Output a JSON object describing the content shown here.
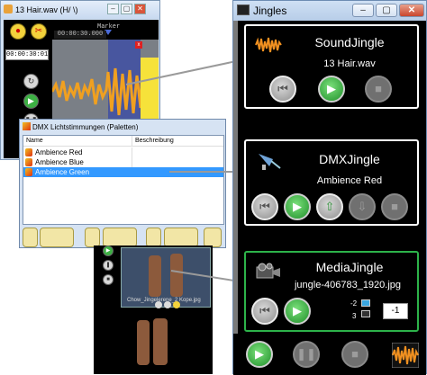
{
  "audio_window": {
    "title": "13 Hair.wav (H/ \\)",
    "marker_label": "Marker",
    "time_top": "00:00:30.000",
    "time_current": "00:00:30:017",
    "colors": {
      "wave": "#f0a020",
      "selection": "#3f4fa3"
    }
  },
  "dmx_window": {
    "title": "DMX Lichtstimmungen (Paletten)",
    "columns": [
      "Name",
      "Beschreibung"
    ],
    "rows": [
      {
        "name": "Ambience Red",
        "selected": false
      },
      {
        "name": "Ambience Blue",
        "selected": false
      },
      {
        "name": "Ambience Green",
        "selected": true
      }
    ],
    "colors": {
      "selection": "#3399ff"
    }
  },
  "media_window": {
    "thumb_caption": "Chow_Jingelerene_2 Kope.jpg"
  },
  "jingles": {
    "title": "Jingles",
    "window_buttons": [
      "–",
      "▢",
      "✕"
    ],
    "panels": [
      {
        "title": "SoundJingle",
        "subtitle": "13 Hair.wav",
        "icon": "waveform-icon",
        "buttons": [
          "rewind-button",
          "play-button",
          "stop-button"
        ]
      },
      {
        "title": "DMXJingle",
        "subtitle": "Ambience Red",
        "icon": "spotlight-icon",
        "buttons": [
          "rewind-button",
          "play-button",
          "up-button",
          "down-button",
          "stop-button"
        ]
      },
      {
        "title": "MediaJingle",
        "subtitle": "jungle-406783_1920.jpg",
        "icon": "projector-icon",
        "screen_values": [
          "-2",
          "3"
        ],
        "number_value": "-1",
        "buttons": [
          "rewind-button",
          "play-button"
        ]
      }
    ],
    "bottom_buttons": [
      "play-all-button",
      "pause-button",
      "stop-all-button"
    ],
    "colors": {
      "accent_green": "#2db34a",
      "play_green": "#1f8f2a"
    }
  }
}
